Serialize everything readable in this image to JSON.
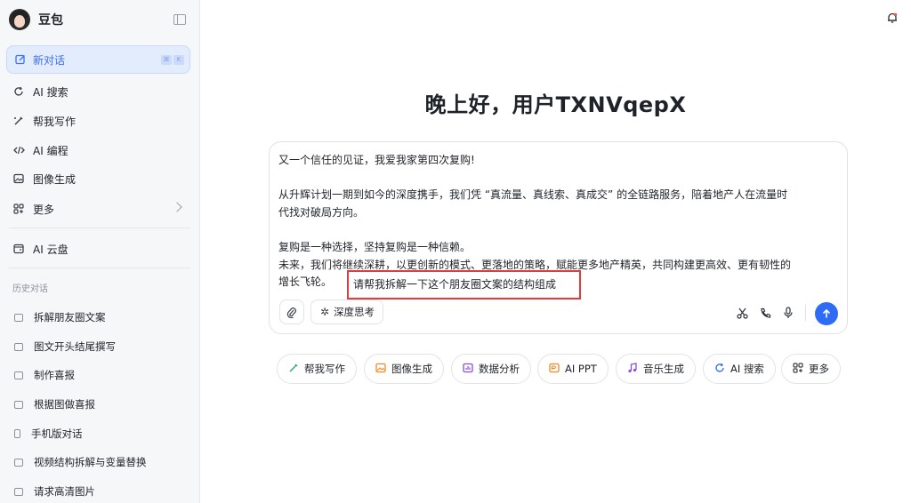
{
  "sidebar": {
    "brand": "豆包",
    "new_chat": "新对话",
    "shortcut_keys": [
      "⌘",
      "K"
    ],
    "nav": [
      {
        "label": "AI 搜索",
        "icon": "search-refresh-icon"
      },
      {
        "label": "帮我写作",
        "icon": "pen-icon"
      },
      {
        "label": "AI 编程",
        "icon": "code-icon"
      },
      {
        "label": "图像生成",
        "icon": "image-icon"
      },
      {
        "label": "更多",
        "icon": "grid-icon"
      },
      {
        "label": "AI 云盘",
        "icon": "cloud-drive-icon"
      }
    ],
    "history_title": "历史对话",
    "history": [
      "拆解朋友圈文案",
      "图文开头结尾撰写",
      "制作喜报",
      "根据图做喜报",
      "手机版对话",
      "视频结构拆解与变量替换",
      "请求高清图片"
    ]
  },
  "main": {
    "greeting": "晚上好，用户TXNVqepX",
    "composer": {
      "lines": [
        "又一个信任的见证，我爱我家第四次复购!",
        "",
        "从升辉计划一期到如今的深度携手，我们凭 “真流量、真线索、真成交” 的全链路服务，陪着地产人在流量时",
        "代找对破局方向。",
        "",
        "复购是一种选择，坚持复购是一种信赖。",
        "未来，我们将继续深耕，以更创新的模式、更落地的策略，赋能更多地产精英，共同构建更高效、更有韧性的",
        "增长飞轮。"
      ],
      "highlighted_prompt": "请帮我拆解一下这个朋友圈文案的结构组成",
      "deep_think": "深度思考"
    },
    "quick_actions": [
      {
        "label": "帮我写作",
        "icon": "pen-icon",
        "color": "#2fa86b"
      },
      {
        "label": "图像生成",
        "icon": "image-icon",
        "color": "#f08a24"
      },
      {
        "label": "数据分析",
        "icon": "chart-icon",
        "color": "#8a4fe0"
      },
      {
        "label": "AI PPT",
        "icon": "ppt-icon",
        "color": "#f08a24"
      },
      {
        "label": "音乐生成",
        "icon": "music-icon",
        "color": "#8a4fe0"
      },
      {
        "label": "AI 搜索",
        "icon": "search-refresh-icon",
        "color": "#2f6cf6"
      },
      {
        "label": "更多",
        "icon": "grid-icon",
        "color": "#3a3f46"
      }
    ]
  },
  "colors": {
    "accent": "#2f6cf6",
    "highlight_border": "#e23b3b",
    "sidebar_bg": "#f6f7f9",
    "new_chat_bg": "#e3ecfd"
  }
}
